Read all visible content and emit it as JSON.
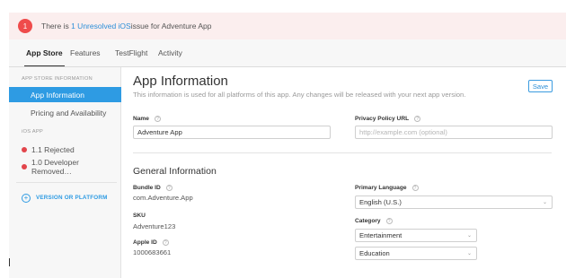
{
  "alert": {
    "badge": "1",
    "prefix": "There is ",
    "link": "1 Unresolved iOS",
    "suffix": " issue for Adventure App"
  },
  "tabs": [
    {
      "label": "App Store",
      "active": true
    },
    {
      "label": "Features",
      "active": false
    },
    {
      "label": "TestFlight",
      "active": false
    },
    {
      "label": "Activity",
      "active": false
    }
  ],
  "sidebar": {
    "heading_app_store": "APP STORE INFORMATION",
    "item_app_information": "App Information",
    "item_pricing": "Pricing and Availability",
    "heading_ios": "iOS APP",
    "item_version_1": "1.1 Rejected",
    "item_version_2": "1.0 Developer Removed…",
    "add_version": "VERSION OR PLATFORM"
  },
  "main": {
    "title": "App Information",
    "subtitle": "This information is used for all platforms of this app. Any changes will be released with your next app version.",
    "save_label": "Save",
    "name_label": "Name",
    "name_value": "Adventure App",
    "privacy_label": "Privacy Policy URL",
    "privacy_placeholder": "http://example.com (optional)",
    "general_title": "General Information",
    "bundle_label": "Bundle ID",
    "bundle_value": "com.Adventure.App",
    "sku_label": "SKU",
    "sku_value": "Adventure123",
    "appleid_label": "Apple ID",
    "appleid_value": "1000683661",
    "primary_lang_label": "Primary Language",
    "primary_lang_value": "English (U.S.)",
    "category_label": "Category",
    "category_primary": "Entertainment",
    "category_secondary": "Education"
  },
  "colors": {
    "accent": "#2e9be3",
    "alert_bg": "#fbeeee",
    "alert_badge": "#ef4b4b",
    "status_dot": "#e2454b"
  }
}
